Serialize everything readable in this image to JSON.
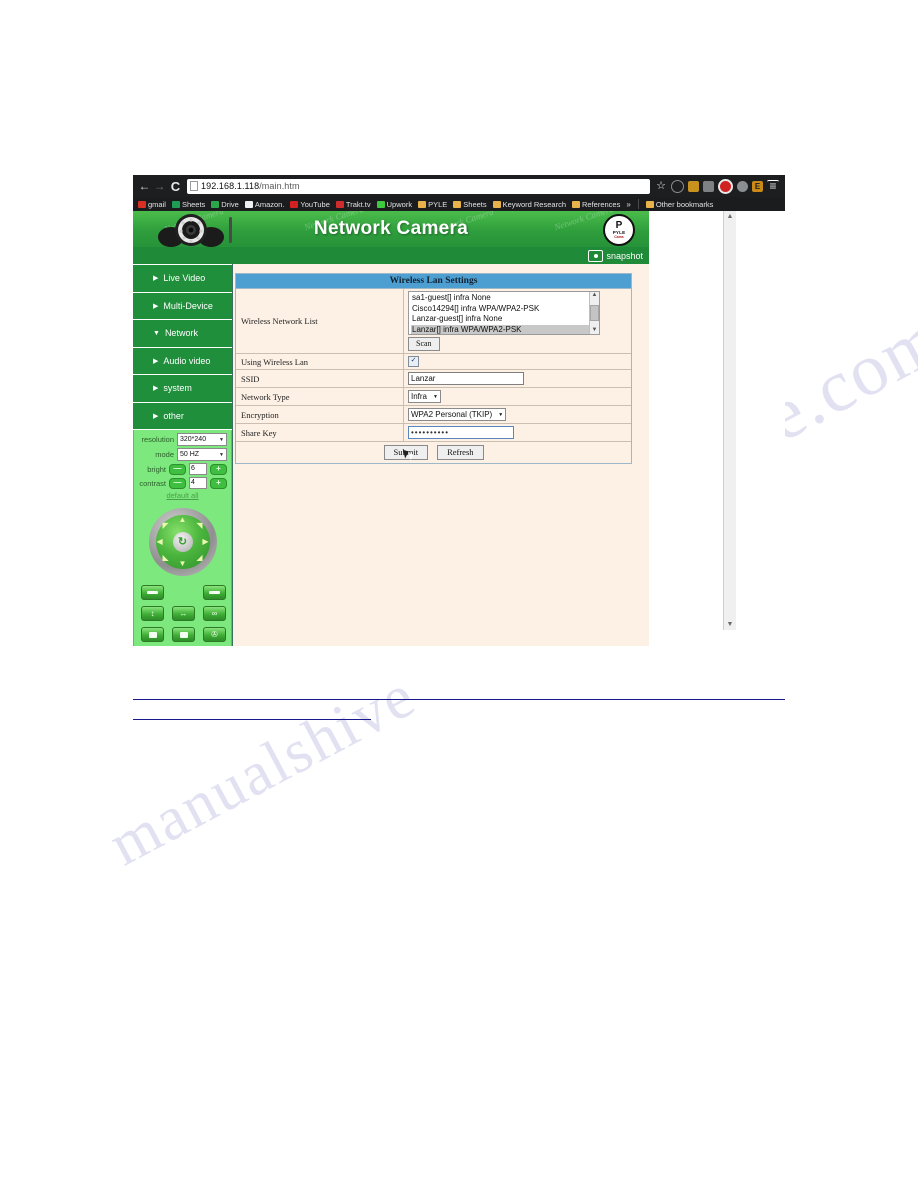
{
  "browser": {
    "back_icon": "back-arrow-icon",
    "forward_icon": "forward-arrow-icon",
    "reload_label": "C",
    "url_host": "192.168.1.118",
    "url_path": "/main.htm",
    "star_glyph": "☆",
    "euro_label": "E",
    "menu_glyph": "≡",
    "toolbar_icons": [
      "star-icon",
      "clock-icon",
      "extension-icon",
      "notes-icon",
      "record-icon",
      "disc-icon",
      "euro-icon",
      "menu-icon"
    ],
    "bookmarks": [
      {
        "label": "gmail",
        "color": "#d93025"
      },
      {
        "label": "Sheets",
        "color": "#1e9e54"
      },
      {
        "label": "Drive",
        "color": "#2aa84a"
      },
      {
        "label": "Amazon.",
        "color": "#f0f0f0"
      },
      {
        "label": "YouTube",
        "color": "#d32020"
      },
      {
        "label": "Trakt.tv",
        "color": "#cf2d2d"
      },
      {
        "label": "Upwork",
        "color": "#3ec93e"
      },
      {
        "label": "PYLE",
        "color": "#e8b34a"
      },
      {
        "label": "Sheets",
        "color": "#e8b34a"
      },
      {
        "label": "Keyword Research",
        "color": "#e8b34a"
      },
      {
        "label": "References",
        "color": "#e8b34a"
      }
    ],
    "overflow_label": "»",
    "other_bookmarks": {
      "label": "Other bookmarks",
      "color": "#e8b34a"
    }
  },
  "camera": {
    "title": "Network Camera",
    "watermark_text": "Network Camera",
    "logo": {
      "letter": "P",
      "brand": "PYLE",
      "sub": "Cams"
    },
    "snapshot_label": "snapshot",
    "menu": [
      {
        "label": "Live Video",
        "arrow": "▶"
      },
      {
        "label": "Multi-Device",
        "arrow": "▶"
      },
      {
        "label": "Network",
        "arrow": "▼"
      },
      {
        "label": "Audio video",
        "arrow": "▶"
      },
      {
        "label": "system",
        "arrow": "▶"
      },
      {
        "label": "other",
        "arrow": "▶"
      }
    ],
    "controls": {
      "resolution_label": "resolution",
      "resolution_value": "320*240",
      "mode_label": "mode",
      "mode_value": "50 HZ",
      "bright_label": "bright",
      "bright_value": "6",
      "contrast_label": "contrast",
      "contrast_value": "4",
      "minus": "—",
      "plus": "+",
      "default_label": "default all",
      "arrow": "▼"
    },
    "ptz": {
      "center_glyph": "↻",
      "up": "▲",
      "down": "▼",
      "left": "◀",
      "right": "▶",
      "ne": "◥",
      "nw": "◤",
      "se": "◢",
      "sw": "◣",
      "buttons": [
        {
          "name": "preset-up-button",
          "glyph": "bar"
        },
        {
          "name": "spacer",
          "glyph": "blank"
        },
        {
          "name": "preset-down-button",
          "glyph": "bar"
        },
        {
          "name": "vertical-patrol-button",
          "glyph": "↕"
        },
        {
          "name": "horizontal-patrol-button",
          "glyph": "↔"
        },
        {
          "name": "loop-button",
          "glyph": "∞"
        },
        {
          "name": "stop-vertical-button",
          "glyph": "sq"
        },
        {
          "name": "stop-horizontal-button",
          "glyph": "sq"
        },
        {
          "name": "io-button",
          "glyph": "✇"
        }
      ]
    }
  },
  "settings": {
    "title": "Wireless Lan Settings",
    "network_list_label": "Wireless Network List",
    "networks": [
      {
        "text": "sa1-guest[] infra None",
        "selected": false
      },
      {
        "text": "Cisco14294[] infra WPA/WPA2-PSK",
        "selected": false
      },
      {
        "text": "Lanzar-guest[] infra None",
        "selected": false
      },
      {
        "text": "Lanzar[] infra WPA/WPA2-PSK",
        "selected": true
      }
    ],
    "scan_label": "Scan",
    "scroll_up": "▲",
    "scroll_down": "▼",
    "using_wireless_label": "Using Wireless Lan",
    "using_wireless_checked": "✓",
    "ssid_label": "SSID",
    "ssid_value": "Lanzar",
    "network_type_label": "Network Type",
    "network_type_value": "Infra",
    "encryption_label": "Encryption",
    "encryption_value": "WPA2 Personal (TKIP)",
    "share_key_label": "Share Key",
    "share_key_value": "••••••••••",
    "dropdown_arrow": "▼",
    "submit_label": "Submit",
    "refresh_label": "Refresh"
  },
  "page": {
    "watermark_left": "manualshive",
    "watermark_right": "manualshive.com"
  }
}
